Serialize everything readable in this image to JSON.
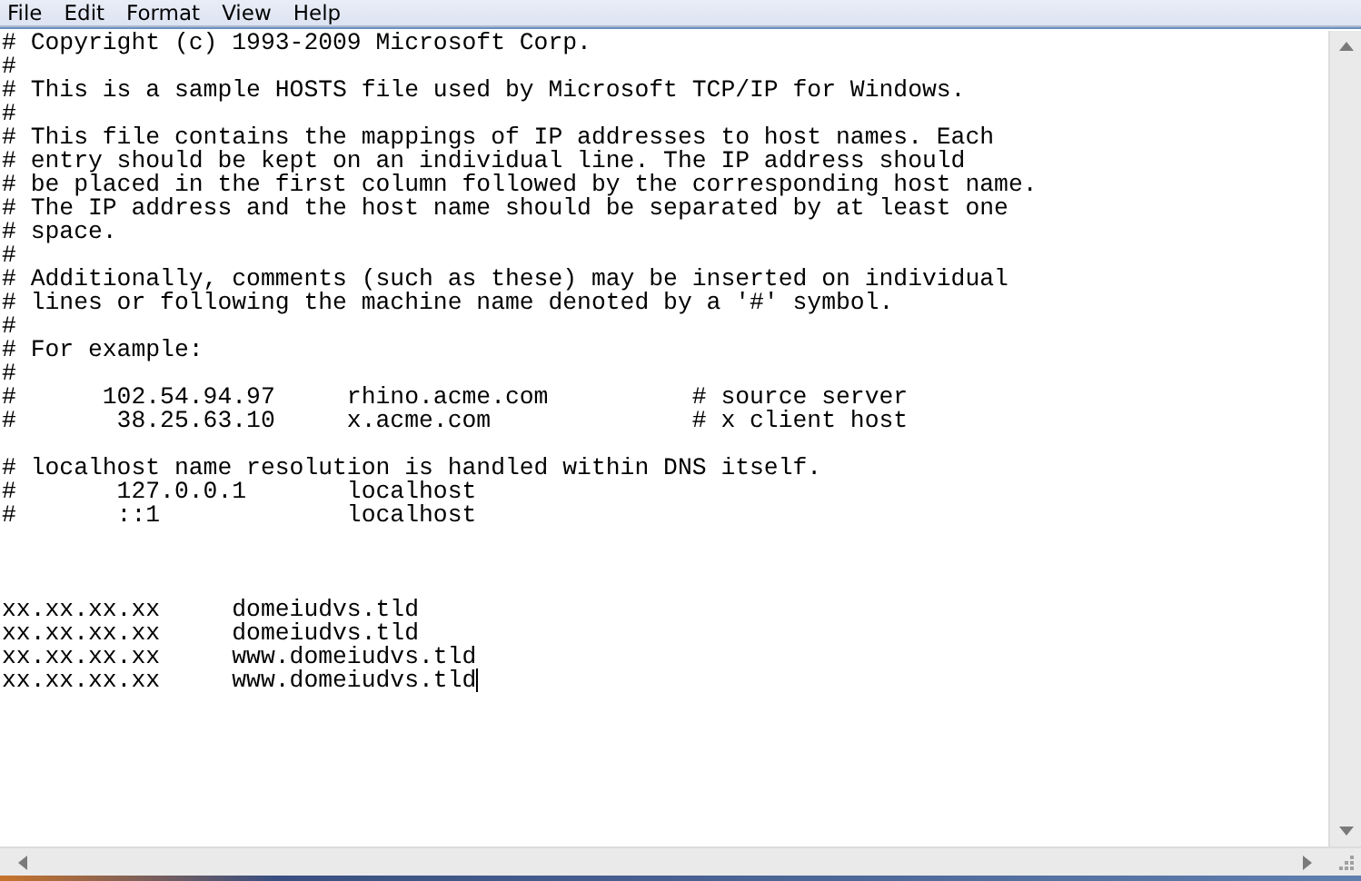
{
  "menu_bar": {
    "items": [
      "File",
      "Edit",
      "Format",
      "View",
      "Help"
    ]
  },
  "editor": {
    "lines": [
      {
        "kind": "text",
        "text": "# Copyright (c) 1993-2009 Microsoft Corp.",
        "caret": false
      },
      {
        "kind": "text",
        "text": "#",
        "caret": false
      },
      {
        "kind": "text",
        "text": "# This is a sample HOSTS file used by Microsoft TCP/IP for Windows.",
        "caret": false
      },
      {
        "kind": "text",
        "text": "#",
        "caret": false
      },
      {
        "kind": "text",
        "text": "# This file contains the mappings of IP addresses to host names. Each",
        "caret": false
      },
      {
        "kind": "text",
        "text": "# entry should be kept on an individual line. The IP address should",
        "caret": false
      },
      {
        "kind": "text",
        "text": "# be placed in the first column followed by the corresponding host name.",
        "caret": false
      },
      {
        "kind": "text",
        "text": "# The IP address and the host name should be separated by at least one",
        "caret": false
      },
      {
        "kind": "text",
        "text": "# space.",
        "caret": false
      },
      {
        "kind": "text",
        "text": "#",
        "caret": false
      },
      {
        "kind": "text",
        "text": "# Additionally, comments (such as these) may be inserted on individual",
        "caret": false
      },
      {
        "kind": "text",
        "text": "# lines or following the machine name denoted by a '#' symbol.",
        "caret": false
      },
      {
        "kind": "text",
        "text": "#",
        "caret": false
      },
      {
        "kind": "text",
        "text": "# For example:",
        "caret": false
      },
      {
        "kind": "text",
        "text": "#",
        "caret": false
      },
      {
        "kind": "text",
        "text": "#      102.54.94.97     rhino.acme.com          # source server",
        "caret": false
      },
      {
        "kind": "text",
        "text": "#       38.25.63.10     x.acme.com              # x client host",
        "caret": false
      },
      {
        "kind": "blank"
      },
      {
        "kind": "text",
        "text": "# localhost name resolution is handled within DNS itself.",
        "caret": false
      },
      {
        "kind": "text",
        "text": "#       127.0.0.1       localhost",
        "caret": false
      },
      {
        "kind": "text",
        "text": "#       ::1             localhost",
        "caret": false
      },
      {
        "kind": "blank"
      },
      {
        "kind": "blank"
      },
      {
        "kind": "blank"
      },
      {
        "kind": "text",
        "text": "xx.xx.xx.xx     domeiudvs.tld",
        "caret": false
      },
      {
        "kind": "text",
        "text": "xx.xx.xx.xx     domeiudvs.tld",
        "caret": false
      },
      {
        "kind": "text",
        "text": "xx.xx.xx.xx     www.domeiudvs.tld",
        "caret": false
      },
      {
        "kind": "text",
        "text": "xx.xx.xx.xx     www.domeiudvs.tld",
        "caret": true
      }
    ]
  }
}
